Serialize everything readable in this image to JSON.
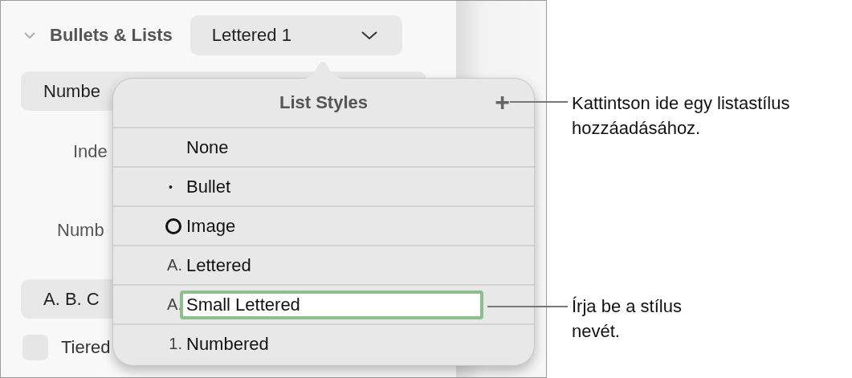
{
  "section": {
    "title": "Bullets & Lists",
    "expanded": true,
    "style_button": "Lettered 1"
  },
  "background": {
    "type_button": "Numbe",
    "indent_label": "Inde",
    "number_label": "Numb",
    "format_button": "A. B. C",
    "tiered": {
      "label": "Tiered",
      "checked": false
    }
  },
  "popover": {
    "title": "List Styles",
    "add_button": "+",
    "items": [
      {
        "kind": "none",
        "label": "None",
        "editing": false
      },
      {
        "kind": "bullet",
        "marker": "•",
        "label": "Bullet",
        "editing": false
      },
      {
        "kind": "image",
        "label": "Image",
        "editing": false
      },
      {
        "kind": "text",
        "marker": "A.",
        "label": "Lettered",
        "editing": false
      },
      {
        "kind": "text",
        "marker": "A.",
        "label": "Small Lettered",
        "editing": true
      },
      {
        "kind": "text",
        "marker": "1.",
        "label": "Numbered",
        "editing": false
      }
    ]
  },
  "callouts": [
    {
      "text": "Kattintson ide egy listastílus hozzáadásához."
    },
    {
      "text": "Írja be a stílus nevét."
    }
  ]
}
